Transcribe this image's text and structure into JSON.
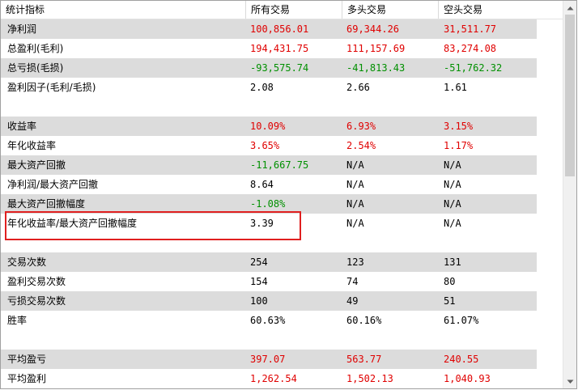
{
  "columns": [
    "统计指标",
    "所有交易",
    "多头交易",
    "空头交易"
  ],
  "rows": [
    {
      "label": "净利润",
      "style": "shaded",
      "values": [
        {
          "v": "100,856.01",
          "c": "red"
        },
        {
          "v": "69,344.26",
          "c": "red"
        },
        {
          "v": "31,511.77",
          "c": "red"
        }
      ]
    },
    {
      "label": "总盈利(毛利)",
      "style": "white",
      "values": [
        {
          "v": "194,431.75",
          "c": "red"
        },
        {
          "v": "111,157.69",
          "c": "red"
        },
        {
          "v": "83,274.08",
          "c": "red"
        }
      ]
    },
    {
      "label": "总亏损(毛损)",
      "style": "shaded",
      "values": [
        {
          "v": "-93,575.74",
          "c": "green"
        },
        {
          "v": "-41,813.43",
          "c": "green"
        },
        {
          "v": "-51,762.32",
          "c": "green"
        }
      ]
    },
    {
      "label": "盈利因子(毛利/毛损)",
      "style": "white",
      "values": [
        {
          "v": "2.08",
          "c": "black"
        },
        {
          "v": "2.66",
          "c": "black"
        },
        {
          "v": "1.61",
          "c": "black"
        }
      ]
    },
    {
      "label": "",
      "style": "sep",
      "values": [
        {
          "v": "",
          "c": "black"
        },
        {
          "v": "",
          "c": "black"
        },
        {
          "v": "",
          "c": "black"
        }
      ]
    },
    {
      "label": "收益率",
      "style": "shaded",
      "values": [
        {
          "v": "10.09%",
          "c": "red"
        },
        {
          "v": "6.93%",
          "c": "red"
        },
        {
          "v": "3.15%",
          "c": "red"
        }
      ]
    },
    {
      "label": "年化收益率",
      "style": "white",
      "values": [
        {
          "v": "3.65%",
          "c": "red"
        },
        {
          "v": "2.54%",
          "c": "red"
        },
        {
          "v": "1.17%",
          "c": "red"
        }
      ]
    },
    {
      "label": "最大资产回撤",
      "style": "shaded",
      "values": [
        {
          "v": "-11,667.75",
          "c": "green"
        },
        {
          "v": "N/A",
          "c": "black"
        },
        {
          "v": "N/A",
          "c": "black"
        }
      ]
    },
    {
      "label": "净利润/最大资产回撤",
      "style": "white",
      "values": [
        {
          "v": "8.64",
          "c": "black"
        },
        {
          "v": "N/A",
          "c": "black"
        },
        {
          "v": "N/A",
          "c": "black"
        }
      ]
    },
    {
      "label": "最大资产回撤幅度",
      "style": "shaded",
      "values": [
        {
          "v": "-1.08%",
          "c": "green"
        },
        {
          "v": "N/A",
          "c": "black"
        },
        {
          "v": "N/A",
          "c": "black"
        }
      ]
    },
    {
      "label": "年化收益率/最大资产回撤幅度",
      "style": "white",
      "values": [
        {
          "v": "3.39",
          "c": "black"
        },
        {
          "v": "N/A",
          "c": "black"
        },
        {
          "v": "N/A",
          "c": "black"
        }
      ]
    },
    {
      "label": "",
      "style": "sep",
      "values": [
        {
          "v": "",
          "c": "black"
        },
        {
          "v": "",
          "c": "black"
        },
        {
          "v": "",
          "c": "black"
        }
      ]
    },
    {
      "label": "交易次数",
      "style": "shaded",
      "values": [
        {
          "v": "254",
          "c": "black"
        },
        {
          "v": "123",
          "c": "black"
        },
        {
          "v": "131",
          "c": "black"
        }
      ]
    },
    {
      "label": "盈利交易次数",
      "style": "white",
      "values": [
        {
          "v": "154",
          "c": "black"
        },
        {
          "v": "74",
          "c": "black"
        },
        {
          "v": "80",
          "c": "black"
        }
      ]
    },
    {
      "label": "亏损交易次数",
      "style": "shaded",
      "values": [
        {
          "v": "100",
          "c": "black"
        },
        {
          "v": "49",
          "c": "black"
        },
        {
          "v": "51",
          "c": "black"
        }
      ]
    },
    {
      "label": "胜率",
      "style": "white",
      "values": [
        {
          "v": "60.63%",
          "c": "black"
        },
        {
          "v": "60.16%",
          "c": "black"
        },
        {
          "v": "61.07%",
          "c": "black"
        }
      ]
    },
    {
      "label": "",
      "style": "sep",
      "values": [
        {
          "v": "",
          "c": "black"
        },
        {
          "v": "",
          "c": "black"
        },
        {
          "v": "",
          "c": "black"
        }
      ]
    },
    {
      "label": "平均盈亏",
      "style": "shaded",
      "values": [
        {
          "v": "397.07",
          "c": "red"
        },
        {
          "v": "563.77",
          "c": "red"
        },
        {
          "v": "240.55",
          "c": "red"
        }
      ]
    },
    {
      "label": "平均盈利",
      "style": "white",
      "values": [
        {
          "v": "1,262.54",
          "c": "red"
        },
        {
          "v": "1,502.13",
          "c": "red"
        },
        {
          "v": "1,040.93",
          "c": "red"
        }
      ]
    }
  ],
  "colors": {
    "positive": "#e00000",
    "negative": "#009000",
    "highlight": "#e02020",
    "row_shade": "#dcdcdc"
  },
  "icons": {
    "scroll_up": "triangle-up-icon",
    "scroll_down": "triangle-down-icon"
  }
}
